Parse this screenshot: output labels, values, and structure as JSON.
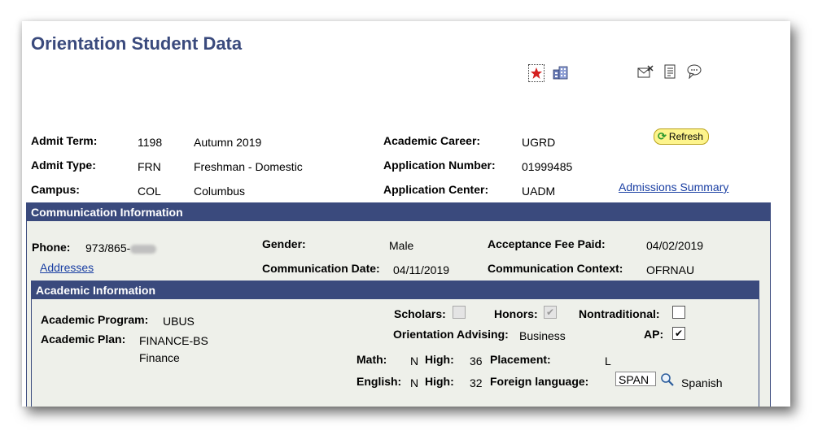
{
  "page": {
    "title": "Orientation Student Data"
  },
  "header": {
    "admit_term": {
      "label": "Admit Term:",
      "code": "1198",
      "desc": "Autumn 2019"
    },
    "admit_type": {
      "label": "Admit Type:",
      "code": "FRN",
      "desc": "Freshman - Domestic"
    },
    "campus": {
      "label": "Campus:",
      "code": "COL",
      "desc": "Columbus"
    },
    "academic_career": {
      "label": "Academic Career:",
      "value": "UGRD"
    },
    "application_number": {
      "label": "Application Number:",
      "value": "01999485"
    },
    "application_center": {
      "label": "Application Center:",
      "value": "UADM"
    },
    "refresh_label": "Refresh",
    "admissions_summary_link": "Admissions Summary"
  },
  "communication": {
    "header": "Communication Information",
    "phone_label": "Phone:",
    "phone_value": "973/865-",
    "addresses_link": "Addresses",
    "gender_label": "Gender:",
    "gender_value": "Male",
    "comm_date_label": "Communication Date:",
    "comm_date_value": "04/11/2019",
    "fee_paid_label": "Acceptance Fee Paid:",
    "fee_paid_value": "04/02/2019",
    "comm_context_label": "Communication Context:",
    "comm_context_value": "OFRNAU"
  },
  "academic": {
    "header": "Academic Information",
    "program_label": "Academic Program:",
    "program_value": "UBUS",
    "plan_label": "Academic Plan:",
    "plan_value": "FINANCE-BS",
    "plan_desc": "Finance",
    "scholars_label": "Scholars:",
    "scholars_checked": false,
    "honors_label": "Honors:",
    "honors_checked": true,
    "nontraditional_label": "Nontraditional:",
    "nontraditional_checked": false,
    "orientation_advising_label": "Orientation Advising:",
    "orientation_advising_value": "Business",
    "ap_label": "AP:",
    "ap_checked": true,
    "math_label": "Math:",
    "math_value": "N",
    "math_high_label": "High:",
    "math_high_value": "36",
    "placement_label": "Placement:",
    "placement_value": "L",
    "english_label": "English:",
    "english_value": "N",
    "english_high_label": "High:",
    "english_high_value": "32",
    "foreign_language_label": "Foreign language:",
    "foreign_language_code": "SPAN",
    "foreign_language_desc": "Spanish"
  },
  "icons": {
    "favorite": "favorite-star-icon",
    "building": "building-icon",
    "notify": "notify-icon",
    "report": "report-icon",
    "comment": "comment-icon",
    "lookup": "magnifier-icon"
  },
  "colors": {
    "title": "#3a4a7d",
    "panel_header": "#3a4a7d",
    "link": "#1a3fa3",
    "refresh_bg": "#fdf48c"
  }
}
